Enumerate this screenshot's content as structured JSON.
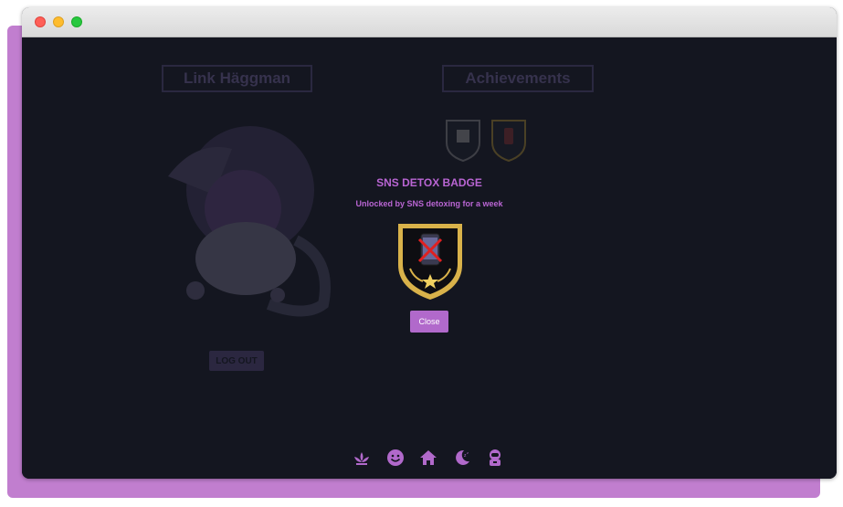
{
  "profile": {
    "name": "Link Häggman",
    "logout_label": "LOG OUT"
  },
  "achievements": {
    "title": "Achievements"
  },
  "modal": {
    "title": "SNS DETOX BADGE",
    "subtitle": "Unlocked by SNS detoxing for a week",
    "close_label": "Close"
  },
  "nav": {
    "items": [
      {
        "icon": "lotus-icon"
      },
      {
        "icon": "smile-icon"
      },
      {
        "icon": "home-icon"
      },
      {
        "icon": "moon-icon"
      },
      {
        "icon": "astronaut-icon"
      }
    ]
  },
  "colors": {
    "accent": "#b965d3",
    "button": "#b169cb",
    "background": "#141620",
    "frame": "#c17ecf",
    "gold": "#d9b24a"
  }
}
